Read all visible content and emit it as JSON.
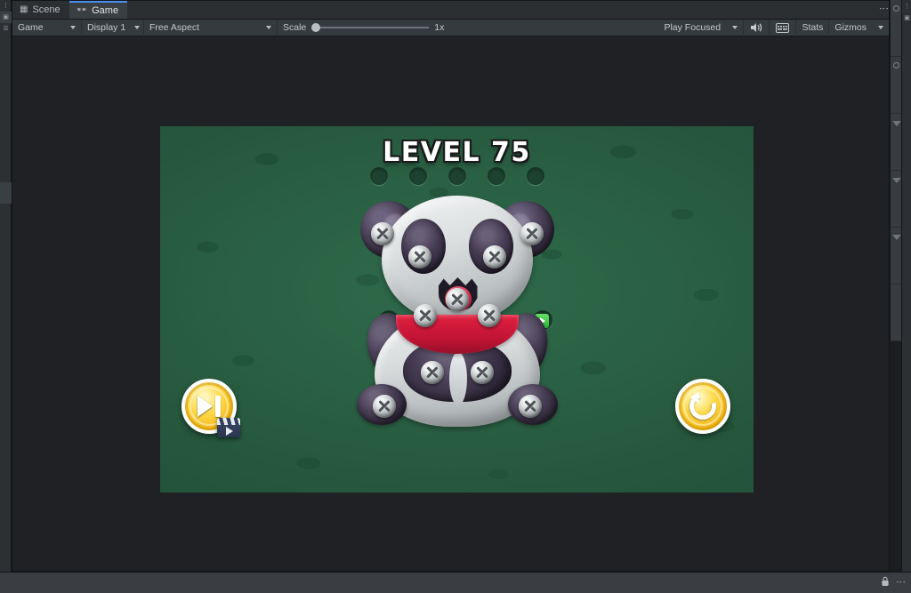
{
  "editor": {
    "tabs": [
      {
        "label": "Scene",
        "icon": "grid-icon",
        "active": false
      },
      {
        "label": "Game",
        "icon": "gamepad-icon",
        "active": true
      }
    ],
    "tab_overflow_menu": "⋮",
    "toolbar": {
      "view_mode": "Game",
      "display": "Display 1",
      "aspect": "Free Aspect",
      "scale_label": "Scale",
      "scale_value": "1x",
      "play_mode": "Play Focused",
      "mute_audio_icon": "speaker-icon",
      "stats_toggle_icon": "frame-debug-icon",
      "stats_label": "Stats",
      "gizmos_label": "Gizmos"
    },
    "statusbar": {
      "lock_icon": "lock-icon",
      "menu_icon": "kebab-icon"
    },
    "accent_color": "#4a8ef0",
    "panel_bg": "#383c40",
    "toolbar_bg": "#353a3e"
  },
  "game": {
    "level_title": "LEVEL 75",
    "background_color": "#26573d",
    "empty_slot_count": 5,
    "slots": [
      {
        "name": "slot-1",
        "state": "empty"
      },
      {
        "name": "slot-2",
        "state": "empty"
      },
      {
        "name": "slot-3",
        "state": "empty"
      },
      {
        "name": "slot-4",
        "state": "empty"
      },
      {
        "name": "slot-5",
        "state": "empty"
      }
    ],
    "board_slots": [
      {
        "name": "board-slot-left",
        "state": "empty"
      },
      {
        "name": "board-slot-right",
        "state": "empty"
      }
    ],
    "character": {
      "name": "panda",
      "screw_count": 12,
      "screw_color": "#c9cdcf",
      "body_color": "#d9dcdd",
      "dark_color": "#473d54",
      "bib_color": "#c21435"
    },
    "cursor_hint": {
      "icon": "play-icon",
      "color": "#29b534"
    },
    "buttons": {
      "skip": {
        "label_icon": "skip-next-icon",
        "badge_icon": "video-ad-icon",
        "color": "#ffd84a"
      },
      "restart": {
        "label_icon": "replay-icon",
        "color": "#ffd84a"
      }
    }
  }
}
